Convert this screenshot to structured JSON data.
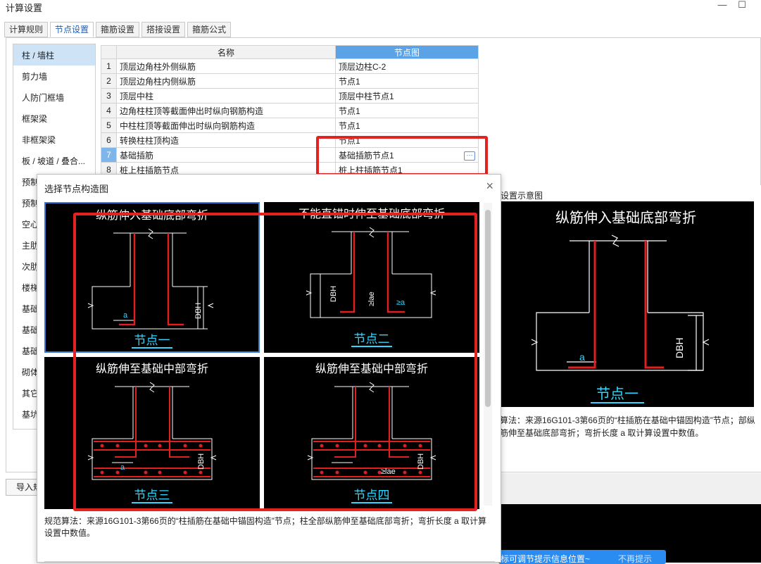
{
  "window": {
    "title": "计算设置",
    "minimize": "—",
    "maximize": "☐"
  },
  "tabs": [
    "计算规则",
    "节点设置",
    "箍筋设置",
    "搭接设置",
    "箍筋公式"
  ],
  "left_list": [
    "柱 / 墙柱",
    "剪力墙",
    "人防门框墙",
    "框架梁",
    "非框架梁",
    "板 / 坡道 / 叠合...",
    "预制",
    "预制",
    "空心",
    "主肋",
    "次肋",
    "楼梯",
    "基础",
    "基础",
    "基础",
    "砌体",
    "其它",
    "基坑"
  ],
  "grid": {
    "headers": {
      "name": "名称",
      "node": "节点图"
    },
    "rows": [
      {
        "n": "1",
        "name": "顶层边角柱外侧纵筋",
        "node": "顶层边柱C-2"
      },
      {
        "n": "2",
        "name": "顶层边角柱内侧纵筋",
        "node": "节点1"
      },
      {
        "n": "3",
        "name": "顶层中柱",
        "node": "顶层中柱节点1"
      },
      {
        "n": "4",
        "name": "边角柱柱顶等截面伸出时纵向钢筋构造",
        "node": "节点1"
      },
      {
        "n": "5",
        "name": "中柱柱顶等截面伸出时纵向钢筋构造",
        "node": "节点1"
      },
      {
        "n": "6",
        "name": "转换柱柱顶构造",
        "node": "节点1"
      },
      {
        "n": "7",
        "name": "基础插筋",
        "node": "基础插筋节点1"
      },
      {
        "n": "8",
        "name": "桩上柱插筋节点",
        "node": "桩上柱插筋节点1"
      }
    ],
    "dots": "···"
  },
  "right_panel": {
    "title": "设置示意图",
    "image_caption": "纵筋伸入基础底部弯折",
    "image_label": "节点一",
    "image_dbh": "DBH",
    "image_a": "a",
    "description": "算法：来源16G101-3第66页的“柱插筋在基础中锚固构造”节点；部纵筋伸至基础底部弯折；弯折长度 a 取计算设置中数值。"
  },
  "import_button": "导入规",
  "tip": {
    "text": "标可调节提示信息位置~",
    "skip": "不再提示"
  },
  "dialog": {
    "title": "选择节点构造图",
    "close": "×",
    "nodes": [
      {
        "caption": "纵筋伸入基础底部弯折",
        "label": "节点一",
        "selected": true
      },
      {
        "caption": "不能直锚时伸至基础底部弯折",
        "label": "节点二",
        "selected": false
      },
      {
        "caption": "纵筋伸至基础中部弯折",
        "label": "节点三",
        "selected": false
      },
      {
        "caption": "纵筋伸至基础中部弯折",
        "label": "节点四",
        "selected": false
      }
    ],
    "dim_labels": {
      "dbh": "DBH",
      "a": "a",
      "lae": "≥lae",
      "a2": "≥a"
    },
    "description": "规范算法：来源16G101-3第66页的“柱插筋在基础中锚固构造”节点；柱全部纵筋伸至基础底部弯折；弯折长度 a 取计算设置中数值。"
  },
  "colors": {
    "accent": "#2a8bf0",
    "highlight": "#e52222",
    "rebar": "#e02020",
    "label": "#2fd6ff"
  }
}
